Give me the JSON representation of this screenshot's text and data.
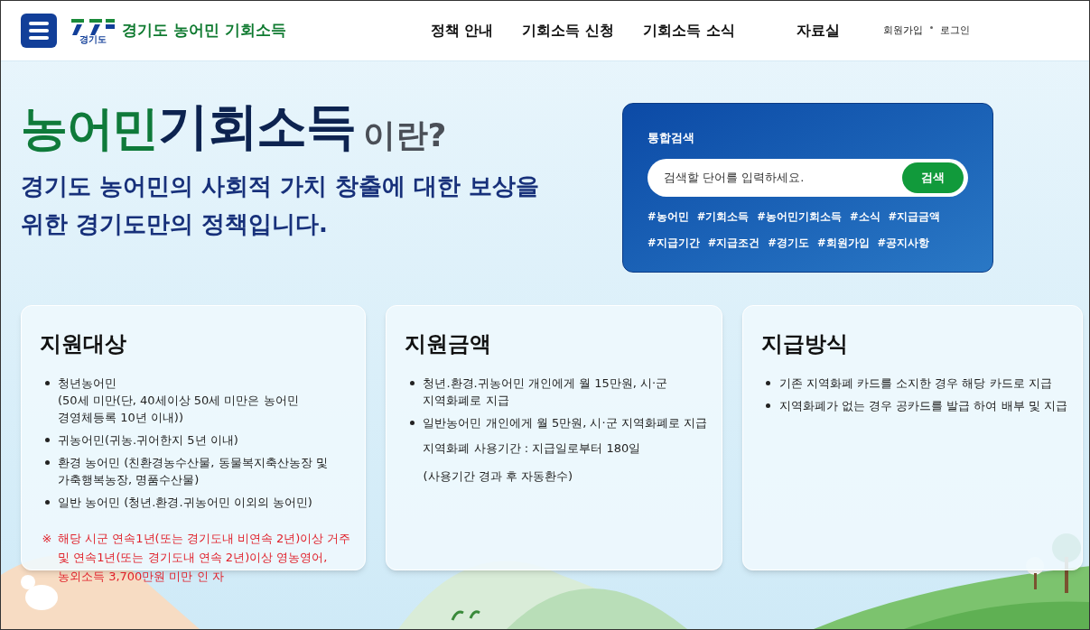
{
  "header": {
    "logo_text": "경기도",
    "site_title": "경기도 농어민 기회소득",
    "nav": [
      {
        "label": "정책 안내"
      },
      {
        "label": "기회소득 신청"
      },
      {
        "label": "기회소득 소식"
      },
      {
        "label": "자료실"
      }
    ],
    "user_links": [
      "회원가입",
      "로그인"
    ]
  },
  "hero": {
    "title_parts": [
      {
        "kind": "green",
        "text": "농어민"
      },
      {
        "kind": "navy",
        "text": "기회소득"
      },
      {
        "kind": "small",
        "text": "이란?"
      }
    ],
    "lines": [
      "경기도 농어민의 사회적 가치 창출에 대한 보상을",
      "위한 경기도만의 정책입니다."
    ]
  },
  "search": {
    "title": "통합검색",
    "placeholder": "검색할 단어를 입력하세요.",
    "button": "검색",
    "tag_rows": [
      [
        "#농어민",
        "#기회소득",
        "#농어민기회소득",
        "#소식",
        "#지급금액"
      ],
      [
        "#지급기간",
        "#지급조건",
        "#경기도",
        "#회원가입",
        "#공지사항"
      ]
    ]
  },
  "cards": [
    {
      "title": "지원대상",
      "items": [
        {
          "kind": "bullet",
          "lines": [
            "청년농어민",
            "(50세 미만(단, 40세이상 50세 미만은 농어민",
            "경영체등록 10년 이내))"
          ]
        },
        {
          "kind": "bullet",
          "lines": [
            "귀농어민(귀농.귀어한지 5년 이내)"
          ]
        },
        {
          "kind": "bullet",
          "lines": [
            "환경 농어민 (친환경농수산물, 동물복지축산농장 및",
            "가축행복농장, 명품수산물)"
          ]
        },
        {
          "kind": "bullet",
          "lines": [
            "일반 농어민 (청년.환경.귀농어민 이외의 농어민)"
          ]
        }
      ],
      "note": {
        "mark": "※",
        "lines": [
          "해당 시군 연속1년(또는 경기도내 비연속 2년)이상 거주",
          "및 연속1년(또는 경기도내 연속 2년)이상 영농영어,",
          "농외소득 3,700만원 미만 인 자"
        ]
      }
    },
    {
      "title": "지원금액",
      "items": [
        {
          "kind": "bullet",
          "lines": [
            "청년.환경.귀농어민 개인에게 월 15만원, 시·군",
            "지역화폐로 지급"
          ]
        },
        {
          "kind": "bullet",
          "lines": [
            "일반농어민 개인에게 월 5만원, 시·군 지역화폐로 지급"
          ]
        },
        {
          "kind": "plain",
          "lines": [
            "지역화폐 사용기간 : 지급일로부터 180일"
          ]
        },
        {
          "kind": "plain",
          "lines": [
            "(사용기간 경과 후 자동환수)"
          ]
        }
      ]
    },
    {
      "title": "지급방식",
      "items": [
        {
          "kind": "bullet",
          "lines": [
            "기존 지역화폐 카드를 소지한 경우 해당 카드로 지급"
          ]
        },
        {
          "kind": "bullet",
          "lines": [
            "지역화폐가 없는 경우 공카드를 발급 하여 배부 및 지급"
          ]
        }
      ]
    }
  ]
}
